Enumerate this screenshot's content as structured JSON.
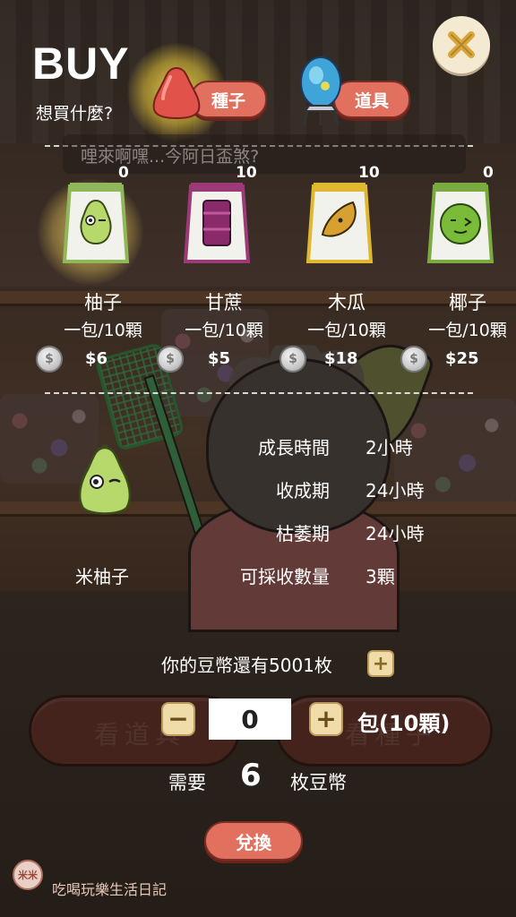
{
  "header": {
    "title": "BUY",
    "subtitle": "想買什麼?"
  },
  "tabs": [
    {
      "label": "種子",
      "icon": "rose-apple-seed-icon",
      "active": true
    },
    {
      "label": "道具",
      "icon": "crystal-ball-icon",
      "active": false
    }
  ],
  "close": {
    "icon": "close-icon"
  },
  "speech": "哩來啊嘿...今阿日盃煞?",
  "seeds": [
    {
      "count": "0",
      "name": "柚子",
      "pack": "一包/10顆",
      "price": "$6",
      "bag_color": "#8fb85a",
      "highlighted": true
    },
    {
      "count": "10",
      "name": "甘蔗",
      "pack": "一包/10顆",
      "price": "$5",
      "bag_color": "#9c3a78",
      "highlighted": false
    },
    {
      "count": "10",
      "name": "木瓜",
      "pack": "一包/10顆",
      "price": "$18",
      "bag_color": "#e0b830",
      "highlighted": false
    },
    {
      "count": "0",
      "name": "椰子",
      "pack": "一包/10顆",
      "price": "$25",
      "bag_color": "#7aaa40",
      "highlighted": false
    }
  ],
  "detail": {
    "name": "米柚子",
    "attributes": [
      {
        "label": "成長時間",
        "value": "2小時"
      },
      {
        "label": "收成期",
        "value": "24小時"
      },
      {
        "label": "枯萎期",
        "value": "24小時"
      },
      {
        "label": "可採收數量",
        "value": "3顆"
      }
    ]
  },
  "wallet": {
    "text": "你的豆幣還有5001枚"
  },
  "background_buttons": {
    "left": "看道具",
    "right": "看種子"
  },
  "quantity": {
    "value": "0",
    "unit": "包(10顆)"
  },
  "cost": {
    "prefix": "需要",
    "amount": "6",
    "suffix": "枚豆幣"
  },
  "exchange_label": "兌換",
  "watermark": {
    "logo": "米米",
    "text": "吃喝玩樂生活日記"
  },
  "colors": {
    "tab": "#e2705e",
    "plus_button": "#efdca8",
    "close_bg": "#f4ead2",
    "close_x": "#d9a63a"
  }
}
